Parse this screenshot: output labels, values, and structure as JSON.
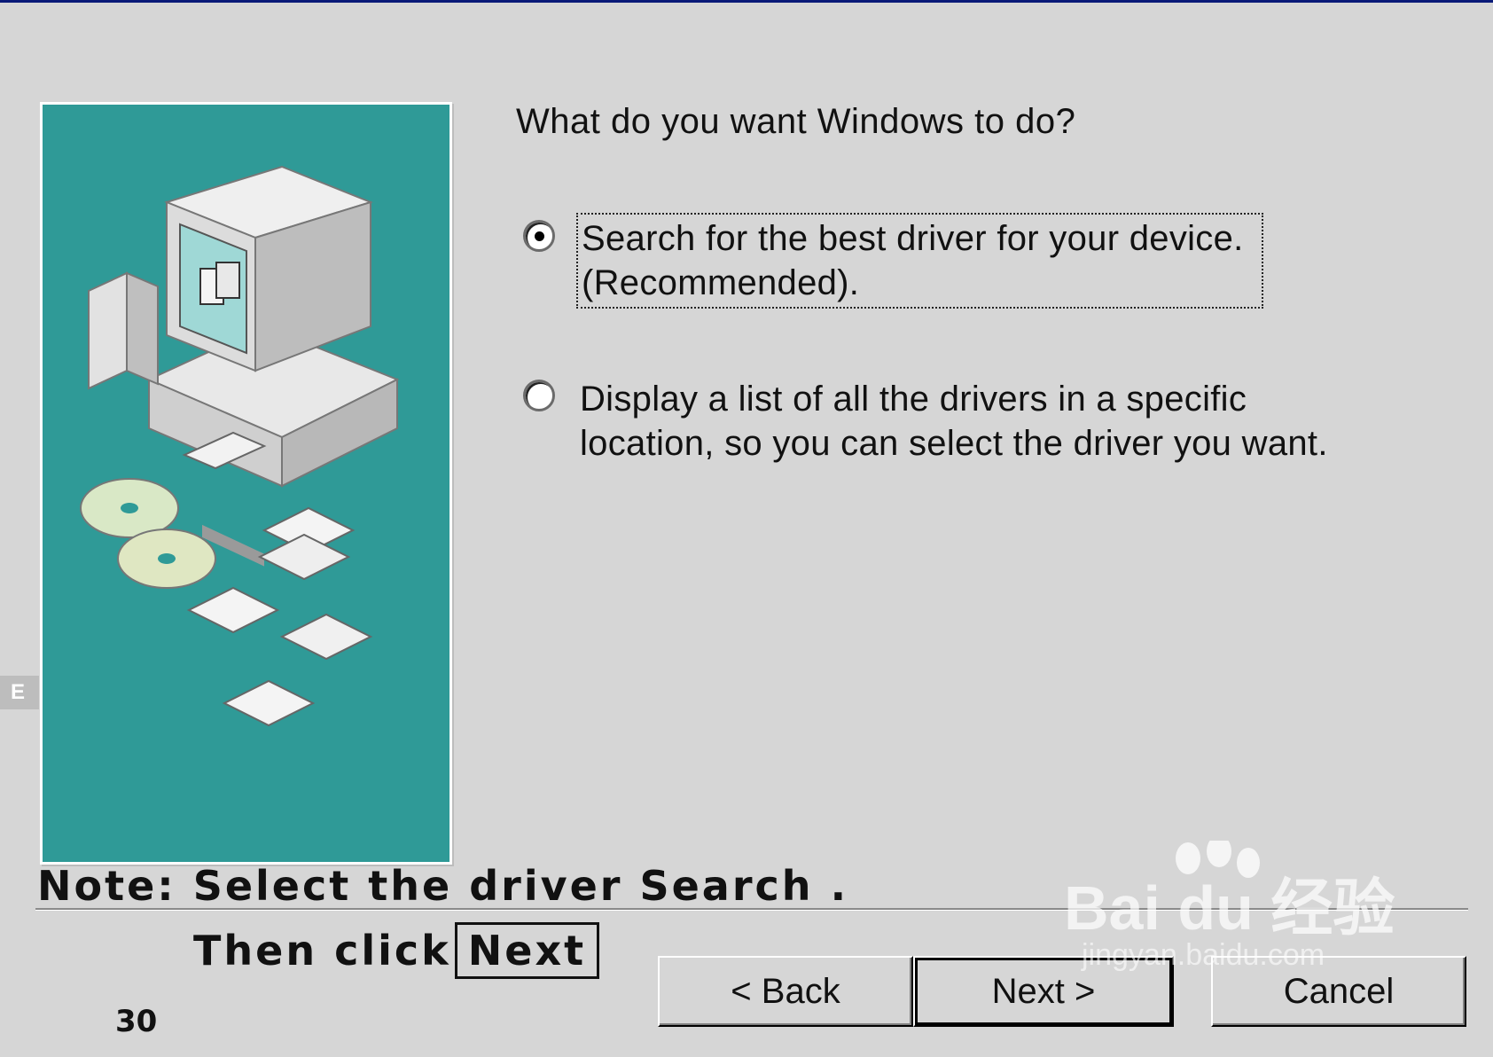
{
  "question": "What do you want Windows to do?",
  "options": [
    {
      "line1": "Search for the best driver for your device.",
      "line2": "(Recommended).",
      "selected": true
    },
    {
      "line1": "Display a list of all the drivers in a specific",
      "line2": "location, so you can select the driver you want.",
      "selected": false
    }
  ],
  "buttons": {
    "back": "< Back",
    "next": "Next >",
    "cancel": "Cancel"
  },
  "note": {
    "line1": "Note: Select  the driver Search .",
    "then_prefix": "Then click",
    "then_boxed": "Next"
  },
  "page_number": "30",
  "section_tab": "E",
  "watermark": {
    "brand": "Bai du 经验",
    "url": "jingyan.baidu.com"
  },
  "colors": {
    "dialog_bg": "#d6d6d6",
    "art_bg": "#2f9a97",
    "top_rule": "#0a1a78"
  },
  "icons": [
    "computer-icon",
    "cd-disc-icon",
    "floppy-disk-icon",
    "radio-selected-icon",
    "radio-unselected-icon"
  ]
}
